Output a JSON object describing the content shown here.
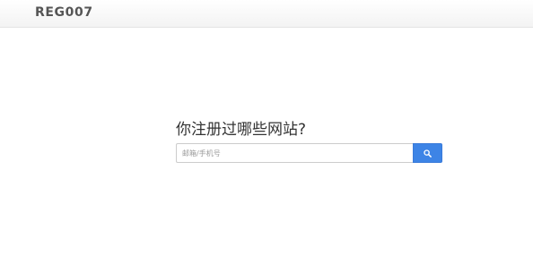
{
  "navbar": {
    "brand": "REG007"
  },
  "main": {
    "headline": "你注册过哪些网站?",
    "search": {
      "placeholder": "邮箱/手机号",
      "value": "",
      "button_icon": "search-icon"
    }
  },
  "colors": {
    "accent": "#3d84e6",
    "brand_text": "#555555",
    "navbar_bg": "#f6f6f6"
  }
}
